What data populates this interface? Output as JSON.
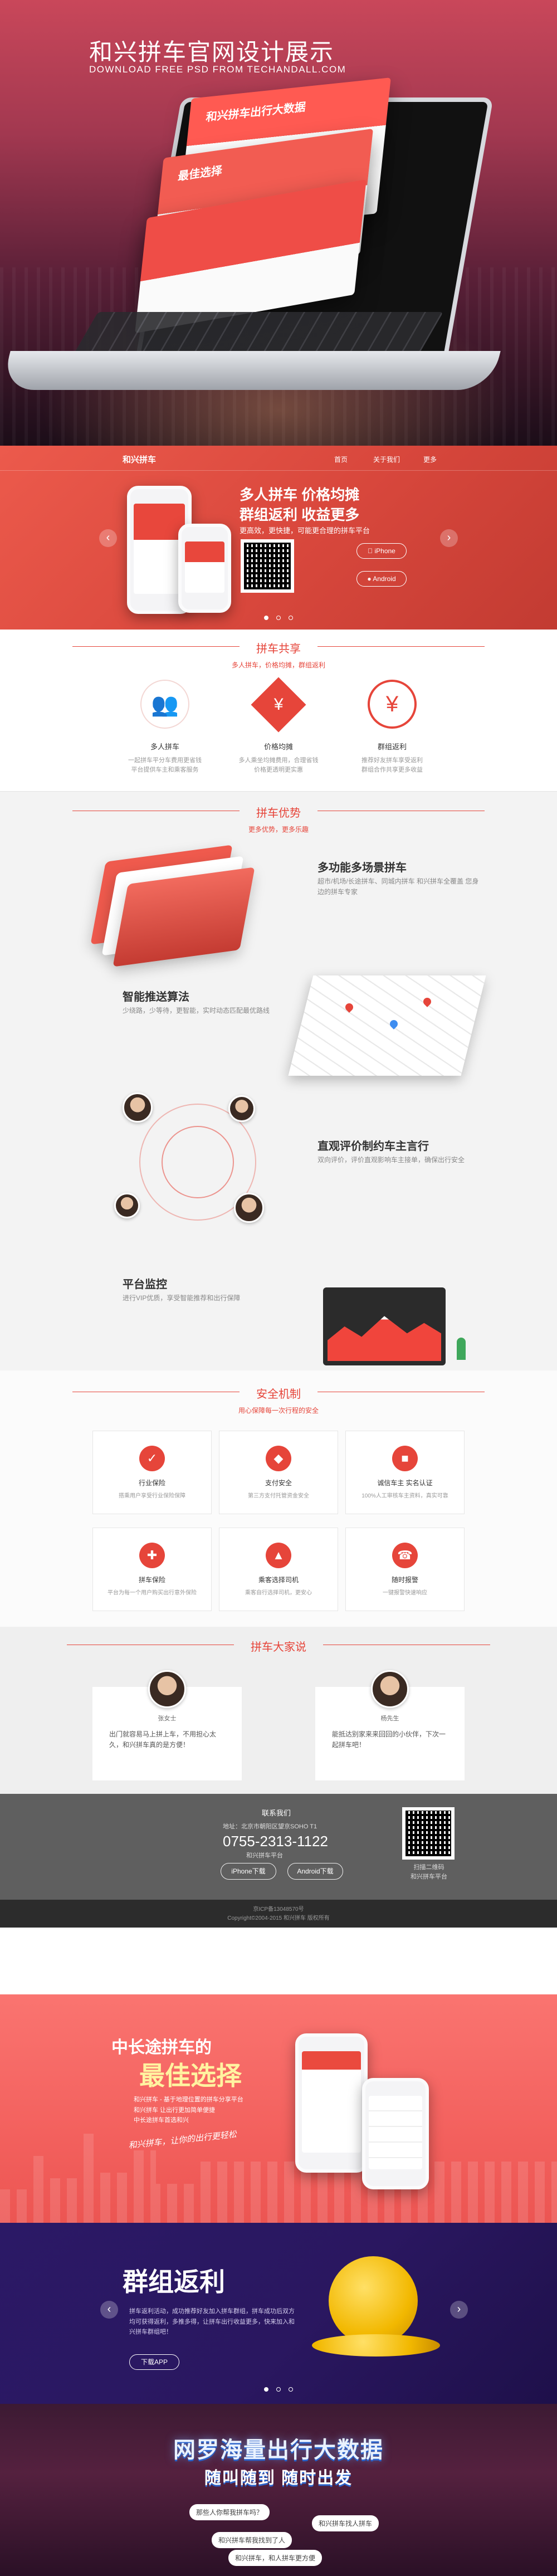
{
  "hero": {
    "title": "和兴拼车官网设计展示",
    "subtitle": "DOWNLOAD FREE PSD FROM TECHANDALL.COM",
    "panel_top": "和兴拼车出行大数据",
    "panel_mid": "最佳选择"
  },
  "colors": {
    "brand_red": "#e6453a",
    "pink": "#f3615e",
    "purple": "#2a1760",
    "footer": "#2c2c2c"
  },
  "nav": {
    "logo": "和兴拼车",
    "items": [
      "首页",
      "关于我们",
      "更多"
    ]
  },
  "banner": {
    "headline_1": "多人拼车  价格均摊",
    "headline_2": "群组返利  收益更多",
    "tagline": "更高效，更快捷，可能更合理的拼车平台",
    "iphone": "iPhone",
    "android": "Android",
    "prev": "‹",
    "next": "›"
  },
  "share": {
    "title": "拼车共享",
    "subtitle": "多人拼车，价格均摊，群组返利",
    "items": [
      {
        "icon": "users-icon",
        "title": "多人拼车",
        "desc": "一起拼车平分车费用更省钱\n平台提供车主和乘客服务"
      },
      {
        "icon": "price-tag-icon",
        "title": "价格均摊",
        "desc": "多人乘坐均摊费用，合理省钱\n价格更透明更实惠"
      },
      {
        "icon": "refund-icon",
        "title": "群组返利",
        "desc": "推荐好友拼车享受返利\n群组合作共享更多收益"
      }
    ]
  },
  "advantage": {
    "title": "拼车优势",
    "subtitle": "更多优势，更多乐趣",
    "items": [
      {
        "title": "多功能多场景拼车",
        "desc": "超市/机场/长途拼车、同城内拼车 和兴拼车全覆盖 您身边的拼车专家"
      },
      {
        "title": "智能推送算法",
        "desc": "少绕路，少等待，更智能，实时动态匹配最优路线"
      },
      {
        "title": "直观评价制约车主言行",
        "desc": "双向评价，评价直观影响车主接单，确保出行安全"
      },
      {
        "title": "平台监控",
        "desc": "进行VIP优质，享受智能推荐和出行保障"
      }
    ]
  },
  "safety": {
    "title": "安全机制",
    "subtitle": "用心保障每一次行程的安全",
    "items": [
      {
        "icon": "shield-icon",
        "title": "行业保险",
        "desc": "搭乘用户享受行业保险保障"
      },
      {
        "icon": "lock-icon",
        "title": "支付安全",
        "desc": "第三方支付托管资金安全"
      },
      {
        "icon": "id-card-icon",
        "title": "诚信车主 实名认证",
        "desc": "100%人工审核车主资料，真实可靠"
      },
      {
        "icon": "insurance-icon",
        "title": "拼车保险",
        "desc": "平台为每一个用户购买出行意外保险"
      },
      {
        "icon": "car-icon",
        "title": "乘客选择司机",
        "desc": "乘客自行选择司机，更安心"
      },
      {
        "icon": "phone-icon",
        "title": "随时报警",
        "desc": "一键报警快速响应"
      }
    ]
  },
  "reviews": {
    "title": "拼车大家说",
    "items": [
      {
        "name": "张女士",
        "text": "出门就容易马上拼上车，不用担心太久，和兴拼车真的是方便！"
      },
      {
        "name": "杨先生",
        "text": "能抵达别家来来回回的小伙伴，下次一起拼车吧！"
      }
    ]
  },
  "contact": {
    "label": "联系我们",
    "address": "地址：北京市朝阳区望京SOHO T1",
    "phone": "0755-2313-1122",
    "platform": "和兴拼车平台",
    "iphone_btn": "iPhone下载",
    "android_btn": "Android下载",
    "qr_caption": "扫描二维码\n和兴拼车平台"
  },
  "footer": {
    "line1": "京ICP备13048570号",
    "line2": "Copyright©2004-2015 和兴拼车 版权所有"
  },
  "promo1": {
    "title_small": "中长途拼车的",
    "title_big": "最佳选择",
    "desc": "和兴拼车 - 基于地理位置的拼车分享平台\n和兴拼车 让出行更加简单便捷\n中长途拼车首选和兴",
    "slogan": "和兴拼车，让你的出行更轻松"
  },
  "promo2": {
    "title": "群组返利",
    "desc": "拼车返利活动，成功推荐好友加入拼车群组，拼车成功后双方均可获得返利，多推多得，让拼车出行收益更多，快来加入和兴拼车群组吧！",
    "download": "下载APP",
    "prev": "‹",
    "next": "›"
  },
  "promo3": {
    "title": "网罗海量出行大数据",
    "subtitle": "随叫随到 随时出发",
    "bubbles": [
      "那些人你帮我拼车吗？",
      "和兴拼车找人拼车",
      "和兴拼车帮我找到了人",
      "和兴拼车，和人拼车更方便"
    ]
  }
}
